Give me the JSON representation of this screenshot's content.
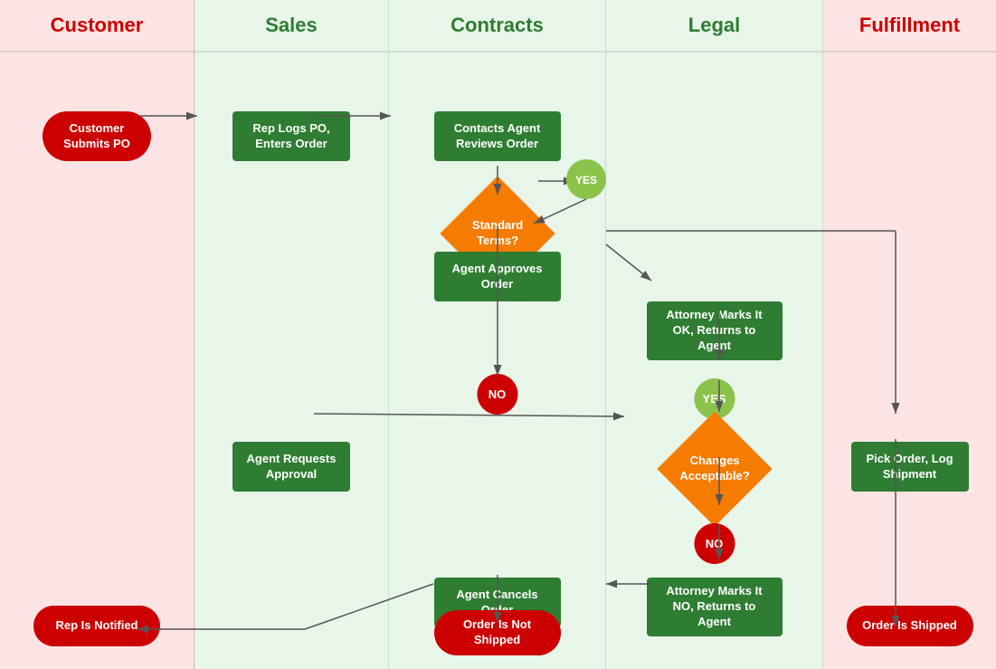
{
  "swimlanes": [
    {
      "id": "customer",
      "label": "Customer",
      "headerClass": "header-customer",
      "bgClass": "swimlane-customer"
    },
    {
      "id": "sales",
      "label": "Sales",
      "headerClass": "header-sales",
      "bgClass": "swimlane-sales"
    },
    {
      "id": "contracts",
      "label": "Contracts",
      "headerClass": "header-contracts",
      "bgClass": "swimlane-contracts"
    },
    {
      "id": "legal",
      "label": "Legal",
      "headerClass": "header-legal",
      "bgClass": "swimlane-legal"
    },
    {
      "id": "fulfillment",
      "label": "Fulfillment",
      "headerClass": "header-fulfillment",
      "bgClass": "swimlane-fulfillment"
    }
  ],
  "nodes": {
    "customer_submits_po": "Customer Submits PO",
    "rep_logs_po": "Rep Logs PO, Enters Order",
    "contacts_agent": "Contacts Agent Reviews Order",
    "standard_terms": "Standard Terms?",
    "agent_approves": "Agent Approves Order",
    "yes_label_1": "YES",
    "no_label_1": "NO",
    "yes_label_2": "YES",
    "no_label_2": "NO",
    "agent_requests": "Agent Requests Approval",
    "attorney_marks_ok": "Attorney Marks It OK, Returns to Agent",
    "changes_acceptable": "Changes Acceptable?",
    "attorney_marks_no": "Attorney Marks It NO, Returns to Agent",
    "agent_cancels": "Agent Cancels Order",
    "rep_is_notified": "Rep Is Notified",
    "order_not_shipped": "Order Is Not Shipped",
    "pick_order": "Pick Order, Log Shipment",
    "order_shipped": "Order Is Shipped"
  }
}
